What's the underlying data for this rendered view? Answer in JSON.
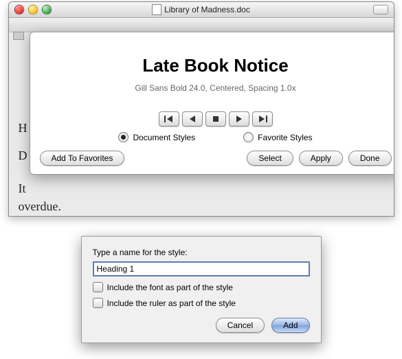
{
  "window": {
    "title": "Library of Madness.doc"
  },
  "background": {
    "line_h": "H",
    "line_d": "D",
    "line_it": "It",
    "line_overdue": "overdue."
  },
  "sheet": {
    "preview_heading": "Late Book Notice",
    "preview_subtitle": "Gill Sans Bold 24.0, Centered, Spacing 1.0x",
    "radio": {
      "document": "Document Styles",
      "favorite": "Favorite Styles",
      "selected": "document"
    },
    "buttons": {
      "add_fav": "Add To Favorites",
      "select": "Select",
      "apply": "Apply",
      "done": "Done"
    },
    "play_controls": [
      "first",
      "prev",
      "stop",
      "next",
      "last"
    ]
  },
  "dialog2": {
    "prompt": "Type a name for the style:",
    "input_value": "Heading 1",
    "chk_font": "Include the font as part of the style",
    "chk_ruler": "Include the ruler as part of the style",
    "cancel": "Cancel",
    "add": "Add"
  }
}
